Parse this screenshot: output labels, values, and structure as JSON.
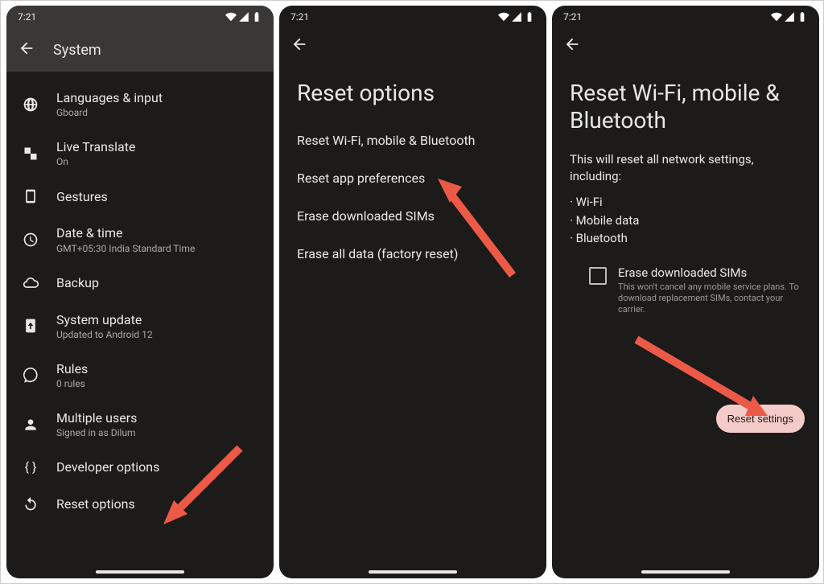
{
  "status": {
    "time": "7:21"
  },
  "screen1": {
    "title": "System",
    "items": [
      {
        "title": "Languages & input",
        "sub": "Gboard"
      },
      {
        "title": "Live Translate",
        "sub": "On"
      },
      {
        "title": "Gestures",
        "sub": ""
      },
      {
        "title": "Date & time",
        "sub": "GMT+05:30 India Standard Time"
      },
      {
        "title": "Backup",
        "sub": ""
      },
      {
        "title": "System update",
        "sub": "Updated to Android 12"
      },
      {
        "title": "Rules",
        "sub": "0 rules"
      },
      {
        "title": "Multiple users",
        "sub": "Signed in as Dilum"
      },
      {
        "title": "Developer options",
        "sub": ""
      },
      {
        "title": "Reset options",
        "sub": ""
      }
    ]
  },
  "screen2": {
    "title": "Reset options",
    "options": [
      "Reset Wi-Fi, mobile & Bluetooth",
      "Reset app preferences",
      "Erase downloaded SIMs",
      "Erase all data (factory reset)"
    ]
  },
  "screen3": {
    "title": "Reset Wi-Fi, mobile & Bluetooth",
    "desc": "This will reset all network settings, including:",
    "bullets": [
      "Wi-Fi",
      "Mobile data",
      "Bluetooth"
    ],
    "checkbox": {
      "title": "Erase downloaded SIMs",
      "sub": "This won't cancel any mobile service plans. To download replacement SIMs, contact your carrier."
    },
    "button": "Reset settings"
  }
}
